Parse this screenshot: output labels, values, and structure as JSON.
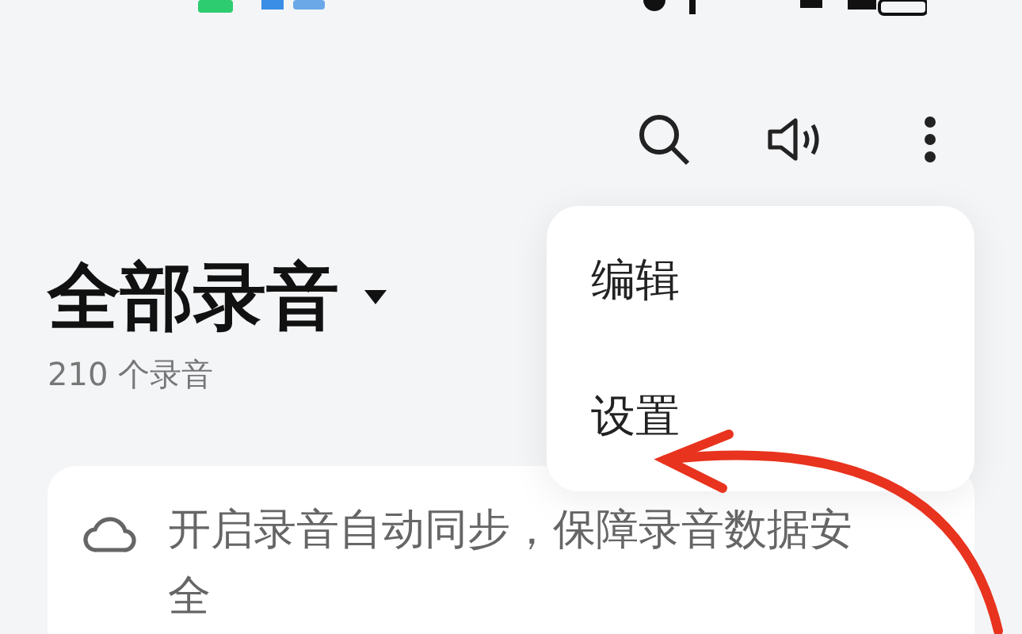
{
  "header": {
    "title": "全部录音",
    "count": "210 个录音"
  },
  "menu": {
    "items": [
      {
        "label": "编辑"
      },
      {
        "label": "设置"
      }
    ]
  },
  "sync_card": {
    "text": "开启录音自动同步，保障录音数据安全"
  }
}
